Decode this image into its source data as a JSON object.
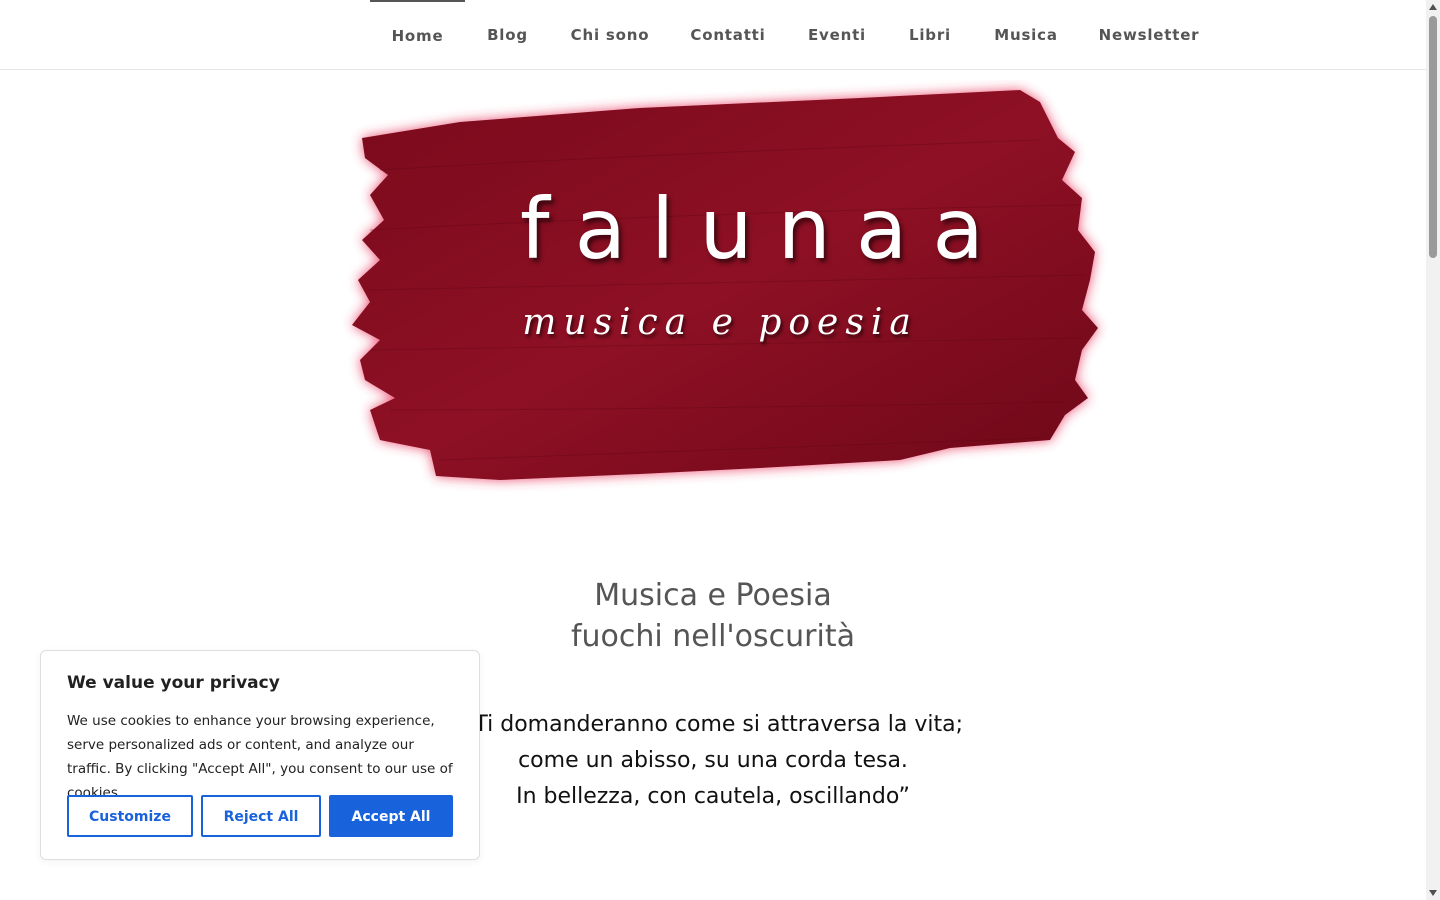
{
  "nav": {
    "items": [
      {
        "label": "Home",
        "active": true
      },
      {
        "label": "Blog"
      },
      {
        "label": "Chi sono"
      },
      {
        "label": "Contatti"
      },
      {
        "label": "Eventi"
      },
      {
        "label": "Libri"
      },
      {
        "label": "Musica"
      },
      {
        "label": "Newsletter"
      }
    ]
  },
  "hero": {
    "brand": "falunaa",
    "tagline": "musica e poesia",
    "seal_icon": "falunaa-seal-icon",
    "brush_color": "#8b0f22",
    "glow_color": "#e8305a"
  },
  "headline": {
    "line1": "Musica e Poesia",
    "line2": "fuochi nell'oscurità"
  },
  "quote": {
    "line1": "“Ti domanderanno come si attraversa la vita;",
    "line2": "come un abisso, su una corda tesa.",
    "line3": "In bellezza, con cautela, oscillando”"
  },
  "cookie": {
    "title": "We value your privacy",
    "text": "We use cookies to enhance your browsing experience, serve personalized ads or content, and analyze our traffic. By clicking \"Accept All\", you consent to our use of cookies.",
    "customize": "Customize",
    "reject": "Reject All",
    "accept": "Accept All",
    "accent_color": "#1863dc"
  }
}
